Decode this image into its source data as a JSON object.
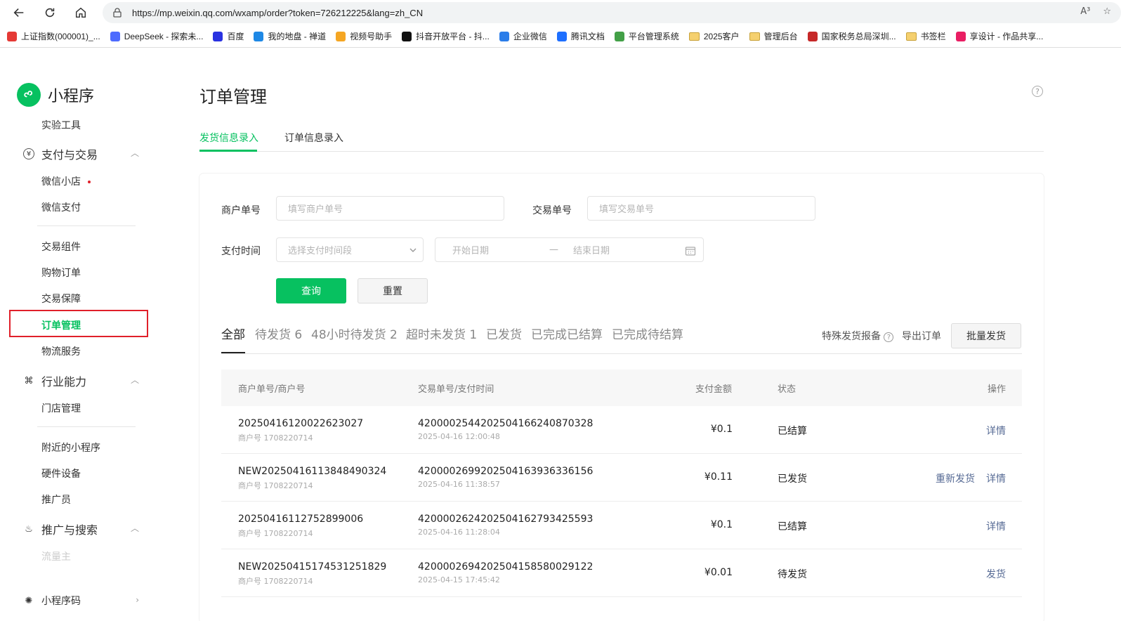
{
  "browser": {
    "url": "https://mp.weixin.qq.com/wxamp/order?token=726212225&lang=zh_CN",
    "read_aloud": "A³",
    "bookmarks": [
      {
        "label": "上证指数(000001)_...",
        "icon": "stock-icon",
        "color": "#e53935"
      },
      {
        "label": "DeepSeek - 探索未...",
        "icon": "deepseek-icon",
        "color": "#4d6bfe"
      },
      {
        "label": "百度",
        "icon": "baidu-icon",
        "color": "#2932e1"
      },
      {
        "label": "我的地盘 - 禅道",
        "icon": "zentao-icon",
        "color": "#1e88e5"
      },
      {
        "label": "视频号助手",
        "icon": "channels-icon",
        "color": "#f5a623"
      },
      {
        "label": "抖音开放平台 - 抖...",
        "icon": "douyin-icon",
        "color": "#111111"
      },
      {
        "label": "企业微信",
        "icon": "wecom-icon",
        "color": "#2b7de9"
      },
      {
        "label": "腾讯文档",
        "icon": "tencent-docs-icon",
        "color": "#1e6fff"
      },
      {
        "label": "平台管理系统",
        "icon": "platform-icon",
        "color": "#43a047"
      },
      {
        "label": "2025客户",
        "icon": "folder-icon",
        "color": "#f5d06f"
      },
      {
        "label": "管理后台",
        "icon": "folder-icon",
        "color": "#f5d06f"
      },
      {
        "label": "国家税务总局深圳...",
        "icon": "tax-icon",
        "color": "#c62828"
      },
      {
        "label": "书签栏",
        "icon": "folder-icon",
        "color": "#f5d06f"
      },
      {
        "label": "享设计 - 作品共享...",
        "icon": "xiangsheji-icon",
        "color": "#e91e63"
      }
    ]
  },
  "sidebar": {
    "logo_text": "小程序",
    "items": {
      "lab_tools": "实验工具",
      "pay_group": "支付与交易",
      "wx_shop": "微信小店",
      "wx_pay": "微信支付",
      "trade_component": "交易组件",
      "shopping_order": "购物订单",
      "trade_guarantee": "交易保障",
      "order_manage": "订单管理",
      "logistics": "物流服务",
      "industry_group": "行业能力",
      "store_manage": "门店管理",
      "nearby": "附近的小程序",
      "hardware": "硬件设备",
      "promoter": "推广员",
      "promo_group": "推广与搜索",
      "traffic_owner": "流量主",
      "code_group": "小程序码"
    }
  },
  "main": {
    "title": "订单管理",
    "tabs": [
      "发货信息录入",
      "订单信息录入"
    ],
    "filters": {
      "merchant_label": "商户单号",
      "merchant_placeholder": "填写商户单号",
      "trade_label": "交易单号",
      "trade_placeholder": "填写交易单号",
      "paytime_label": "支付时间",
      "paytime_placeholder": "选择支付时间段",
      "start_date": "开始日期",
      "date_sep": "—",
      "end_date": "结束日期",
      "query": "查询",
      "reset": "重置"
    },
    "status_tabs": [
      "全部",
      "待发货 6",
      "48小时待发货 2",
      "超时未发货 1",
      "已发货",
      "已完成已结算",
      "已完成待结算"
    ],
    "actions": {
      "special": "特殊发货报备",
      "export": "导出订单",
      "batch": "批量发货"
    },
    "table": {
      "headers": [
        "商户单号/商户号",
        "交易单号/支付时间",
        "支付金额",
        "状态",
        "操作"
      ],
      "rows": [
        {
          "merchant_no": "20250416120022623027",
          "merchant_id": "商户号 1708220714",
          "trade_no": "4200002544202504166240870328",
          "pay_time": "2025-04-16 12:00:48",
          "amount": "¥0.1",
          "status": "已结算",
          "ops": [
            "详情"
          ]
        },
        {
          "merchant_no": "NEW20250416113848490324",
          "merchant_id": "商户号 1708220714",
          "trade_no": "4200002699202504163936336156",
          "pay_time": "2025-04-16 11:38:57",
          "amount": "¥0.11",
          "status": "已发货",
          "ops": [
            "重新发货",
            "详情"
          ]
        },
        {
          "merchant_no": "20250416112752899006",
          "merchant_id": "商户号 1708220714",
          "trade_no": "4200002624202504162793425593",
          "pay_time": "2025-04-16 11:28:04",
          "amount": "¥0.1",
          "status": "已结算",
          "ops": [
            "详情"
          ]
        },
        {
          "merchant_no": "NEW20250415174531251829",
          "merchant_id": "商户号 1708220714",
          "trade_no": "4200002694202504158580029122",
          "pay_time": "2025-04-15 17:45:42",
          "amount": "¥0.01",
          "status": "待发货",
          "ops": [
            "发货"
          ]
        }
      ]
    }
  },
  "colors": {
    "accent": "#07c160",
    "link": "#576b95",
    "highlight_box": "#e0202a"
  }
}
